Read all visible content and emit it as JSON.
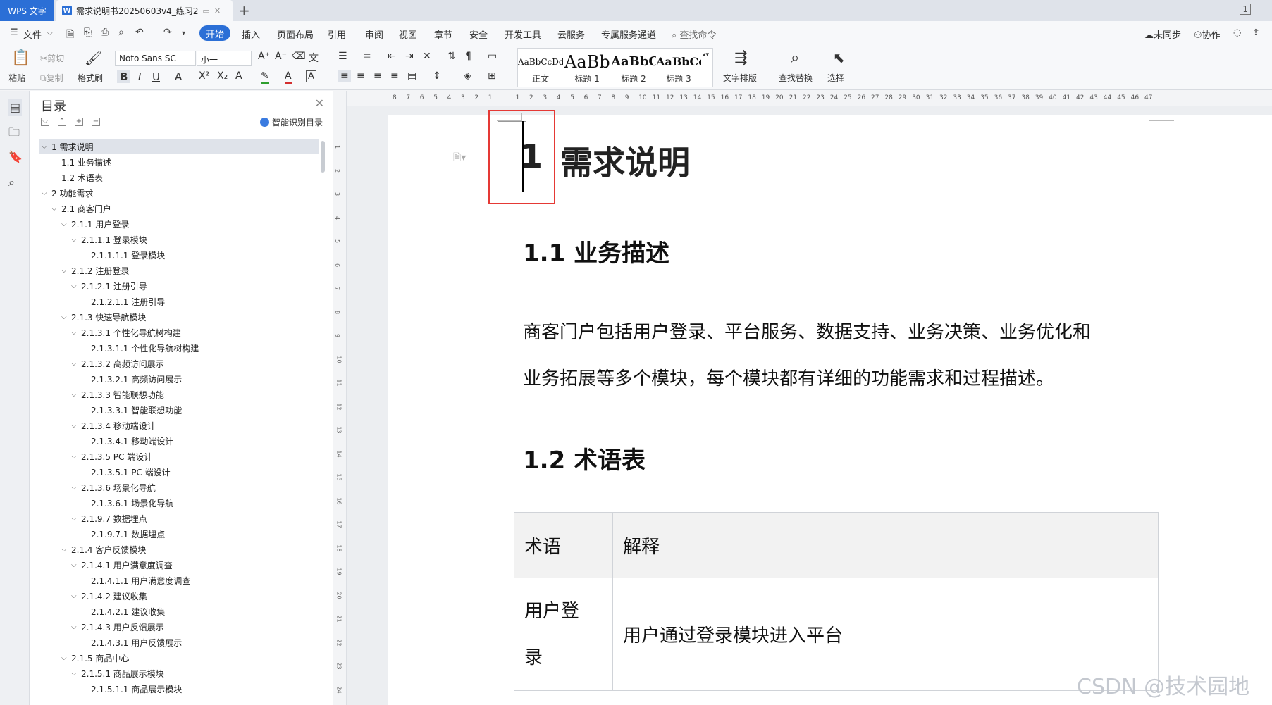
{
  "tabs": {
    "app": "WPS 文字",
    "doc": "需求说明书20250603v4_练习2",
    "new_tab": "+"
  },
  "menu": {
    "file": "文件",
    "items": [
      "开始",
      "插入",
      "页面布局",
      "引用",
      "审阅",
      "视图",
      "章节",
      "安全",
      "开发工具",
      "云服务",
      "专属服务通道"
    ],
    "search_cmd": "查找命令",
    "sync": "未同步",
    "collab": "协作"
  },
  "ribbon": {
    "paste": "粘贴",
    "cut": "剪切",
    "copy": "复制",
    "format_painter": "格式刷",
    "font_name": "Noto Sans SC",
    "font_size": "小一",
    "styles": [
      {
        "sample": "AaBbCcDd",
        "label": "正文"
      },
      {
        "sample": "AaBb",
        "label": "标题 1"
      },
      {
        "sample": "AaBbC",
        "label": "标题 2"
      },
      {
        "sample": "AaBbCcI",
        "label": "标题 3"
      }
    ],
    "text_layout": "文字排版",
    "find_replace": "查找替换",
    "select": "选择"
  },
  "toc": {
    "title": "目录",
    "smart": "智能识别目录",
    "items": [
      {
        "text": "1  需求说明",
        "level": 0,
        "expanded": true,
        "selected": true
      },
      {
        "text": "1.1  业务描述",
        "level": 1,
        "expanded": false
      },
      {
        "text": "1.2  术语表",
        "level": 1,
        "expanded": false
      },
      {
        "text": "2  功能需求",
        "level": 0,
        "expanded": true
      },
      {
        "text": "2.1  商客门户",
        "level": 1,
        "expanded": true
      },
      {
        "text": "2.1.1  用户登录",
        "level": 2,
        "expanded": true
      },
      {
        "text": "2.1.1.1  登录模块",
        "level": 3,
        "expanded": true
      },
      {
        "text": "2.1.1.1.1  登录模块",
        "level": 4,
        "expanded": false
      },
      {
        "text": "2.1.2  注册登录",
        "level": 2,
        "expanded": true
      },
      {
        "text": "2.1.2.1  注册引导",
        "level": 3,
        "expanded": true
      },
      {
        "text": "2.1.2.1.1  注册引导",
        "level": 4,
        "expanded": false
      },
      {
        "text": "2.1.3  快速导航模块",
        "level": 2,
        "expanded": true
      },
      {
        "text": "2.1.3.1  个性化导航树构建",
        "level": 3,
        "expanded": true
      },
      {
        "text": "2.1.3.1.1  个性化导航树构建",
        "level": 4,
        "expanded": false
      },
      {
        "text": "2.1.3.2  高频访问展示",
        "level": 3,
        "expanded": true
      },
      {
        "text": "2.1.3.2.1  高频访问展示",
        "level": 4,
        "expanded": false
      },
      {
        "text": "2.1.3.3  智能联想功能",
        "level": 3,
        "expanded": true
      },
      {
        "text": "2.1.3.3.1  智能联想功能",
        "level": 4,
        "expanded": false
      },
      {
        "text": "2.1.3.4  移动端设计",
        "level": 3,
        "expanded": true
      },
      {
        "text": "2.1.3.4.1  移动端设计",
        "level": 4,
        "expanded": false
      },
      {
        "text": "2.1.3.5 PC 端设计",
        "level": 3,
        "expanded": true
      },
      {
        "text": "2.1.3.5.1 PC 端设计",
        "level": 4,
        "expanded": false
      },
      {
        "text": "2.1.3.6  场景化导航",
        "level": 3,
        "expanded": true
      },
      {
        "text": "2.1.3.6.1  场景化导航",
        "level": 4,
        "expanded": false
      },
      {
        "text": "2.1.9.7  数据埋点",
        "level": 3,
        "expanded": true
      },
      {
        "text": "2.1.9.7.1  数据埋点",
        "level": 4,
        "expanded": false
      },
      {
        "text": "2.1.4  客户反馈模块",
        "level": 2,
        "expanded": true
      },
      {
        "text": "2.1.4.1  用户满意度调查",
        "level": 3,
        "expanded": true
      },
      {
        "text": "2.1.4.1.1  用户满意度调查",
        "level": 4,
        "expanded": false
      },
      {
        "text": "2.1.4.2  建议收集",
        "level": 3,
        "expanded": true
      },
      {
        "text": "2.1.4.2.1  建议收集",
        "level": 4,
        "expanded": false
      },
      {
        "text": "2.1.4.3  用户反馈展示",
        "level": 3,
        "expanded": true
      },
      {
        "text": "2.1.4.3.1  用户反馈展示",
        "level": 4,
        "expanded": false
      },
      {
        "text": "2.1.5  商品中心",
        "level": 2,
        "expanded": true
      },
      {
        "text": "2.1.5.1  商品展示模块",
        "level": 3,
        "expanded": true
      },
      {
        "text": "2.1.5.1.1  商品展示模块",
        "level": 4,
        "expanded": false
      }
    ]
  },
  "ruler": {
    "h": [
      "8",
      "7",
      "6",
      "5",
      "4",
      "3",
      "2",
      "1",
      "",
      "1",
      "2",
      "3",
      "4",
      "5",
      "6",
      "7",
      "8",
      "9",
      "10",
      "11",
      "12",
      "13",
      "14",
      "15",
      "16",
      "17",
      "18",
      "19",
      "20",
      "21",
      "22",
      "23",
      "24",
      "25",
      "26",
      "27",
      "28",
      "29",
      "30",
      "31",
      "32",
      "33",
      "34",
      "35",
      "36",
      "37",
      "38",
      "39",
      "40",
      "41",
      "42",
      "43",
      "44",
      "45",
      "46",
      "47"
    ],
    "v": [
      "1",
      "2",
      "3",
      "4",
      "5",
      "6",
      "7",
      "8",
      "9",
      "10",
      "11",
      "12",
      "13",
      "14",
      "15",
      "16",
      "17",
      "18",
      "19",
      "20",
      "21",
      "22",
      "23",
      "24"
    ]
  },
  "document": {
    "h1_num": "1",
    "h1_title": "需求说明",
    "h2_1": "1.1  业务描述",
    "para_line1": "商客门户包括用户登录、平台服务、数据支持、业务决策、业务优化和",
    "para_line2": "业务拓展等多个模块，每个模块都有详细的功能需求和过程描述。",
    "h2_2": "1.2  术语表",
    "table": {
      "headers": [
        "术语",
        "解释"
      ],
      "rows": [
        [
          "用户登\n录",
          "用户通过登录模块进入平台"
        ]
      ]
    }
  },
  "watermark": "CSDN @技术园地",
  "colors": {
    "accent": "#2b6fd6",
    "highlight_box": "#e53935"
  }
}
